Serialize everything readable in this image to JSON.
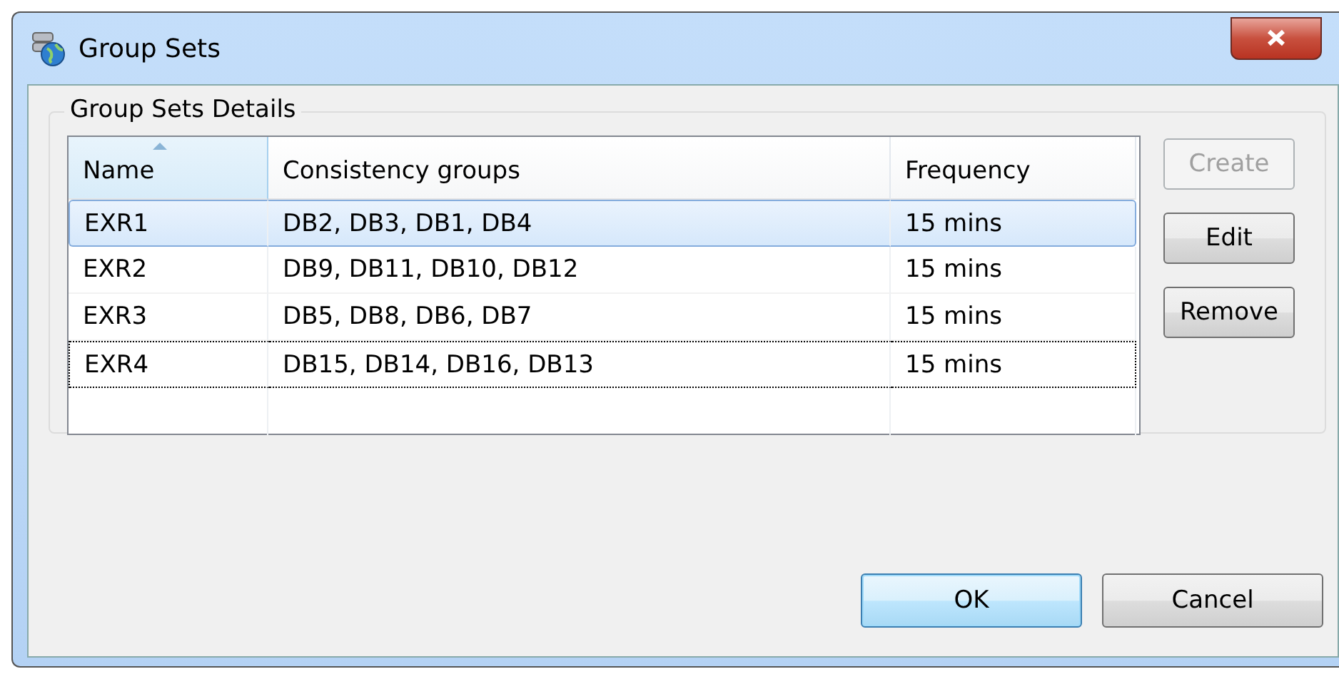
{
  "window": {
    "title": "Group Sets"
  },
  "group": {
    "title": "Group Sets Details"
  },
  "table": {
    "columns": [
      {
        "label": "Name",
        "sorted": true
      },
      {
        "label": "Consistency groups",
        "sorted": false
      },
      {
        "label": "Frequency",
        "sorted": false
      }
    ],
    "rows": [
      {
        "cells": [
          "EXR1",
          "DB2, DB3, DB1, DB4",
          "15 mins"
        ],
        "selected": true,
        "focused": false
      },
      {
        "cells": [
          "EXR2",
          "DB9, DB11, DB10, DB12",
          "15 mins"
        ],
        "selected": false,
        "focused": false
      },
      {
        "cells": [
          "EXR3",
          "DB5, DB8, DB6, DB7",
          "15 mins"
        ],
        "selected": false,
        "focused": false
      },
      {
        "cells": [
          "EXR4",
          "DB15, DB14, DB16, DB13",
          "15 mins"
        ],
        "selected": false,
        "focused": true
      }
    ]
  },
  "side_buttons": [
    {
      "label": "Create",
      "disabled": true
    },
    {
      "label": "Edit",
      "disabled": false
    },
    {
      "label": "Remove",
      "disabled": false
    }
  ],
  "footer_buttons": [
    {
      "label": "OK",
      "default": true
    },
    {
      "label": "Cancel",
      "default": false
    }
  ]
}
